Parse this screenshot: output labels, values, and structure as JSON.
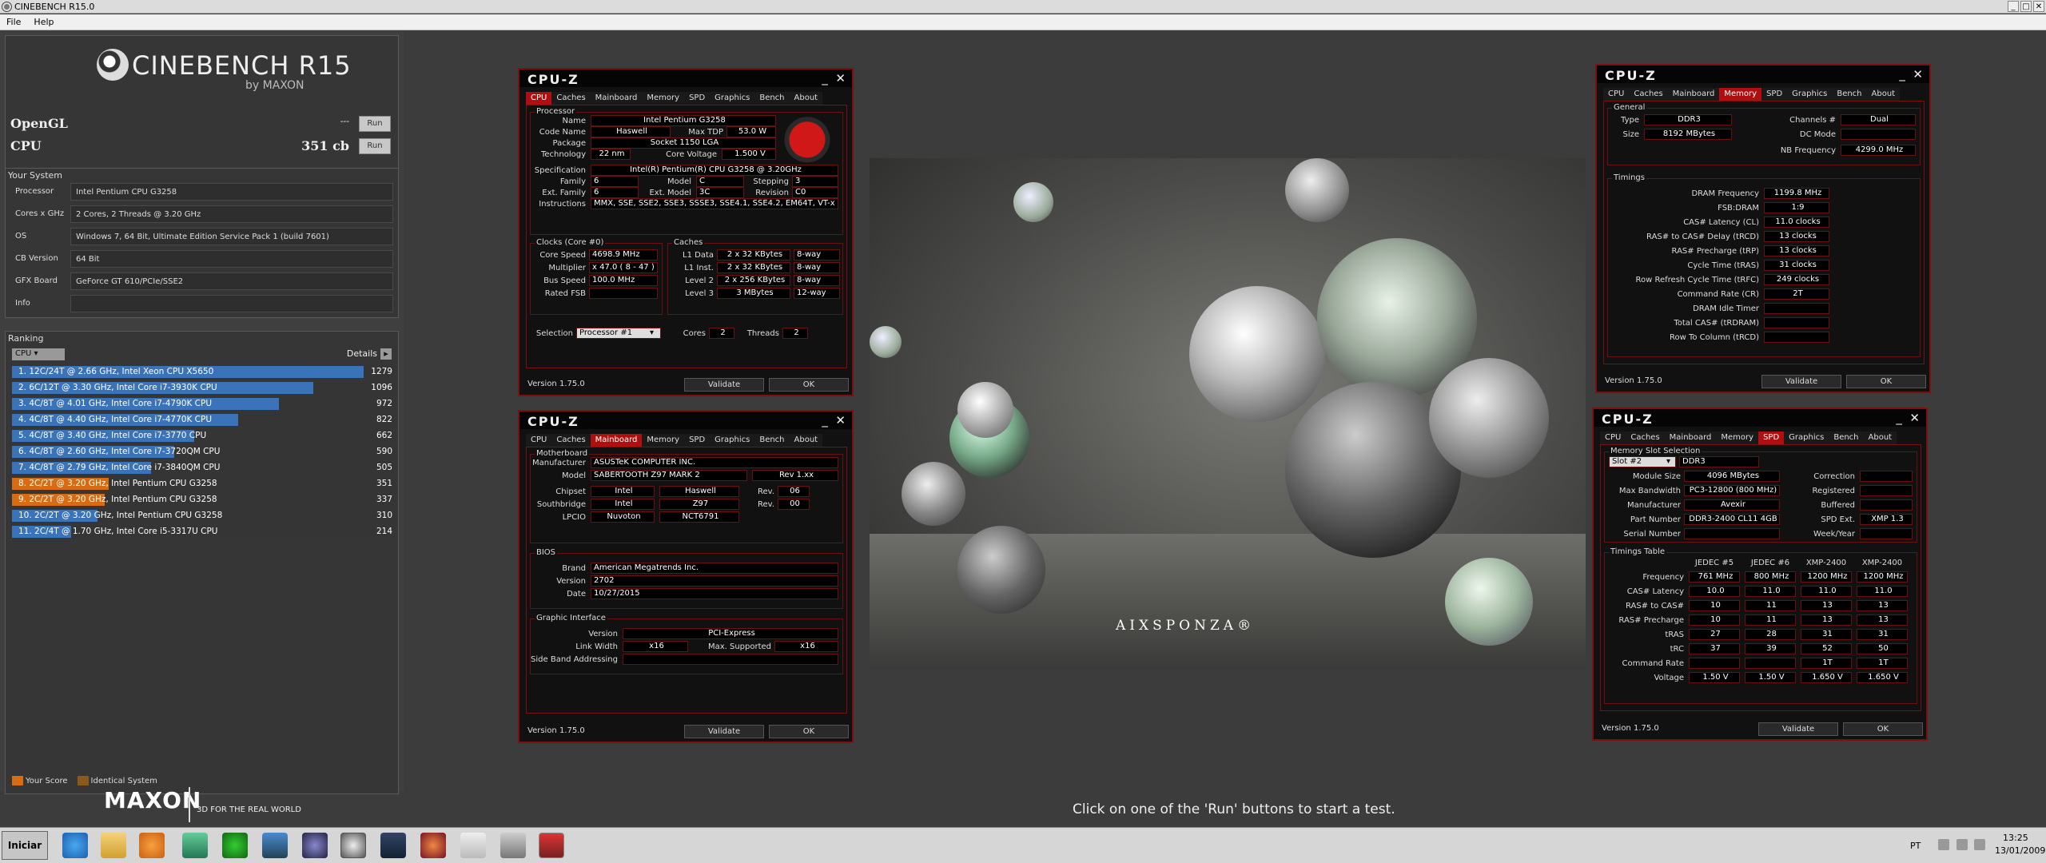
{
  "window": {
    "title": "CINEBENCH R15.0",
    "menu": [
      "File",
      "Help"
    ]
  },
  "logo": {
    "brand": "CINEBENCH R15",
    "by": "by MAXON"
  },
  "scores": [
    {
      "label": "OpenGL",
      "value": "---",
      "run": "Run"
    },
    {
      "label": "CPU",
      "value": "351 cb",
      "run": "Run"
    }
  ],
  "system": {
    "heading": "Your System",
    "rows": [
      {
        "k": "Processor",
        "v": "Intel Pentium CPU G3258"
      },
      {
        "k": "Cores x GHz",
        "v": "2 Cores, 2 Threads @ 3.20 GHz"
      },
      {
        "k": "OS",
        "v": "Windows 7, 64 Bit, Ultimate Edition Service Pack 1 (build 7601)"
      },
      {
        "k": "CB Version",
        "v": "64 Bit"
      },
      {
        "k": "GFX Board",
        "v": "GeForce GT 610/PCIe/SSE2"
      },
      {
        "k": "Info",
        "v": ""
      }
    ]
  },
  "ranking": {
    "heading": "Ranking",
    "select": "CPU",
    "details": "Details",
    "details_icon": "▸",
    "max": 1279,
    "rows": [
      {
        "label": "1. 12C/24T @ 2.66 GHz, Intel Xeon CPU X5650",
        "score": "1279",
        "value": 1279,
        "mine": false
      },
      {
        "label": "2. 6C/12T @ 3.30 GHz,  Intel Core i7-3930K CPU",
        "score": "1096",
        "value": 1096,
        "mine": false
      },
      {
        "label": "3. 4C/8T @ 4.01 GHz, Intel Core i7-4790K CPU",
        "score": "972",
        "value": 972,
        "mine": false
      },
      {
        "label": "4. 4C/8T @ 4.40 GHz, Intel Core i7-4770K CPU",
        "score": "822",
        "value": 822,
        "mine": false
      },
      {
        "label": "5. 4C/8T @ 3.40 GHz,  Intel Core i7-3770 CPU",
        "score": "662",
        "value": 662,
        "mine": false
      },
      {
        "label": "6. 4C/8T @ 2.60 GHz, Intel Core i7-3720QM CPU",
        "score": "590",
        "value": 590,
        "mine": false
      },
      {
        "label": "7. 4C/8T @ 2.79 GHz,  Intel Core i7-3840QM CPU",
        "score": "505",
        "value": 505,
        "mine": false
      },
      {
        "label": "8. 2C/2T @ 3.20 GHz, Intel Pentium CPU G3258",
        "score": "351",
        "value": 351,
        "mine": true
      },
      {
        "label": "9. 2C/2T @ 3.20 GHz, Intel Pentium CPU G3258",
        "score": "337",
        "value": 337,
        "mine": true
      },
      {
        "label": "10. 2C/2T @ 3.20 GHz, Intel Pentium CPU G3258",
        "score": "310",
        "value": 310,
        "mine": false
      },
      {
        "label": "11. 2C/4T @ 1.70 GHz,  Intel Core i5-3317U CPU",
        "score": "214",
        "value": 214,
        "mine": false
      }
    ],
    "legend_your": "Your Score",
    "legend_identical": "Identical System"
  },
  "maxon": {
    "brand": "MAXON",
    "tag": "3D FOR THE REAL WORLD"
  },
  "render": {
    "watermark": "AIXSPONZA®"
  },
  "status": "Click on one of the 'Run' buttons to start a test.",
  "colors": {
    "bar": "#3b73b9",
    "your": "#d96c10",
    "identical": "#8a5a1a",
    "cpuz_red": "#b10f0f"
  },
  "cpuz_cpu": {
    "title": "CPU-Z",
    "tabs": [
      "CPU",
      "Caches",
      "Mainboard",
      "Memory",
      "SPD",
      "Graphics",
      "Bench",
      "About"
    ],
    "active": 0,
    "processor": "Processor",
    "name": "Intel Pentium G3258",
    "codename": "Haswell",
    "maxtdp": "53.0 W",
    "package": "Socket 1150 LGA",
    "technology": "22 nm",
    "corevoltage": "1.500 V",
    "spec": "Intel(R) Pentium(R) CPU G3258 @ 3.20GHz",
    "family": "6",
    "model": "C",
    "stepping": "3",
    "extfamily": "6",
    "extmodel": "3C",
    "revision": "C0",
    "instructions": "MMX, SSE, SSE2, SSE3, SSSE3, SSE4.1, SSE4.2, EM64T, VT-x",
    "clocks": "Clocks (Core #0)",
    "corespeed": "4698.9 MHz",
    "multiplier": "x 47.0 ( 8 - 47 )",
    "busspeed": "100.0 MHz",
    "ratedfsb": "",
    "caches": "Caches",
    "l1d": "2 x 32 KBytes",
    "l1dw": "8-way",
    "l1i": "2 x 32 KBytes",
    "l1iw": "8-way",
    "l2": "2 x 256 KBytes",
    "l2w": "8-way",
    "l3": "3 MBytes",
    "l3w": "12-way",
    "selection": "Processor #1",
    "cores": "2",
    "threads": "2",
    "version": "Version 1.75.0",
    "validate": "Validate",
    "ok": "OK",
    "labels": {
      "name": "Name",
      "codename": "Code Name",
      "maxtdp": "Max TDP",
      "package": "Package",
      "technology": "Technology",
      "corevoltage": "Core Voltage",
      "spec": "Specification",
      "family": "Family",
      "model": "Model",
      "stepping": "Stepping",
      "extfamily": "Ext. Family",
      "extmodel": "Ext. Model",
      "revision": "Revision",
      "instructions": "Instructions",
      "corespeed": "Core Speed",
      "multiplier": "Multiplier",
      "busspeed": "Bus Speed",
      "ratedfsb": "Rated FSB",
      "l1d": "L1 Data",
      "l1i": "L1 Inst.",
      "l2": "Level 2",
      "l3": "Level 3",
      "selection": "Selection",
      "cores": "Cores",
      "threads": "Threads"
    }
  },
  "cpuz_mb": {
    "title": "CPU-Z",
    "tabs": [
      "CPU",
      "Caches",
      "Mainboard",
      "Memory",
      "SPD",
      "Graphics",
      "Bench",
      "About"
    ],
    "active": 2,
    "motherboard": "Motherboard",
    "manufacturer": "ASUSTeK COMPUTER INC.",
    "model": "SABERTOOTH Z97 MARK 2",
    "modelrev": "Rev 1.xx",
    "chipset": "Intel",
    "chipset2": "Haswell",
    "chipsetrev": "06",
    "southbridge": "Intel",
    "southbridge2": "Z97",
    "southrev": "00",
    "lpcio": "Nuvoton",
    "lpcio2": "NCT6791",
    "bios": "BIOS",
    "brand": "American Megatrends Inc.",
    "biosver": "2702",
    "date": "10/27/2015",
    "gi": "Graphic Interface",
    "giver": "PCI-Express",
    "linkwidth": "x16",
    "maxsup": "x16",
    "sideband": "",
    "version": "Version 1.75.0",
    "validate": "Validate",
    "ok": "OK",
    "labels": {
      "manufacturer": "Manufacturer",
      "model": "Model",
      "chipset": "Chipset",
      "southbridge": "Southbridge",
      "lpcio": "LPCIO",
      "rev": "Rev.",
      "brand": "Brand",
      "biosver": "Version",
      "date": "Date",
      "giver": "Version",
      "linkwidth": "Link Width",
      "maxsup": "Max. Supported",
      "sideband": "Side Band Addressing"
    }
  },
  "cpuz_mem": {
    "title": "CPU-Z",
    "tabs": [
      "CPU",
      "Caches",
      "Mainboard",
      "Memory",
      "SPD",
      "Graphics",
      "Bench",
      "About"
    ],
    "active": 3,
    "general": "General",
    "type": "DDR3",
    "channels": "Dual",
    "size": "8192 MBytes",
    "dcmode": "",
    "nbfreq": "4299.0 MHz",
    "timings": "Timings",
    "dramfreq": "1199.8 MHz",
    "fsbdram": "1:9",
    "cas": "11.0 clocks",
    "rcd": "13 clocks",
    "rp": "13 clocks",
    "ras": "31 clocks",
    "rfc": "249 clocks",
    "cr": "2T",
    "idle": "",
    "tcas": "",
    "rtc": "",
    "version": "Version 1.75.0",
    "validate": "Validate",
    "ok": "OK",
    "labels": {
      "type": "Type",
      "channels": "Channels #",
      "size": "Size",
      "dcmode": "DC Mode",
      "nbfreq": "NB Frequency",
      "dramfreq": "DRAM Frequency",
      "fsbdram": "FSB:DRAM",
      "cas": "CAS# Latency (CL)",
      "rcd": "RAS# to CAS# Delay (tRCD)",
      "rp": "RAS# Precharge (tRP)",
      "ras": "Cycle Time (tRAS)",
      "rfc": "Row Refresh Cycle Time (tRFC)",
      "cr": "Command Rate (CR)",
      "idle": "DRAM Idle Timer",
      "tcas": "Total CAS# (tRDRAM)",
      "rtc": "Row To Column (tRCD)"
    }
  },
  "cpuz_spd": {
    "title": "CPU-Z",
    "tabs": [
      "CPU",
      "Caches",
      "Mainboard",
      "Memory",
      "SPD",
      "Graphics",
      "Bench",
      "About"
    ],
    "active": 4,
    "slotsel": "Memory Slot Selection",
    "slot": "Slot #2",
    "slottype": "DDR3",
    "modsize": "4096 MBytes",
    "maxbw": "PC3-12800 (800 MHz)",
    "manuf": "Avexir",
    "part": "DDR3-2400 CL11 4GB",
    "serial": "",
    "correction": "",
    "registered": "",
    "buffered": "",
    "spdext": "XMP 1.3",
    "week": "",
    "tt": "Timings Table",
    "cols": [
      "JEDEC #5",
      "JEDEC #6",
      "XMP-2400",
      "XMP-2400"
    ],
    "rows": [
      {
        "k": "Frequency",
        "v": [
          "761 MHz",
          "800 MHz",
          "1200 MHz",
          "1200 MHz"
        ]
      },
      {
        "k": "CAS# Latency",
        "v": [
          "10.0",
          "11.0",
          "11.0",
          "11.0"
        ]
      },
      {
        "k": "RAS# to CAS#",
        "v": [
          "10",
          "11",
          "13",
          "13"
        ]
      },
      {
        "k": "RAS# Precharge",
        "v": [
          "10",
          "11",
          "13",
          "13"
        ]
      },
      {
        "k": "tRAS",
        "v": [
          "27",
          "28",
          "31",
          "31"
        ]
      },
      {
        "k": "tRC",
        "v": [
          "37",
          "39",
          "52",
          "50"
        ]
      },
      {
        "k": "Command Rate",
        "v": [
          "",
          "",
          "1T",
          "1T"
        ]
      },
      {
        "k": "Voltage",
        "v": [
          "1.50 V",
          "1.50 V",
          "1.650 V",
          "1.650 V"
        ]
      }
    ],
    "version": "Version 1.75.0",
    "validate": "Validate",
    "ok": "OK",
    "labels": {
      "modsize": "Module Size",
      "maxbw": "Max Bandwidth",
      "manuf": "Manufacturer",
      "part": "Part Number",
      "serial": "Serial Number",
      "correction": "Correction",
      "registered": "Registered",
      "buffered": "Buffered",
      "spdext": "SPD Ext.",
      "week": "Week/Year"
    }
  },
  "taskbar": {
    "start": "Iniciar",
    "lang": "PT",
    "time": "13:25",
    "date": "13/01/2009"
  }
}
